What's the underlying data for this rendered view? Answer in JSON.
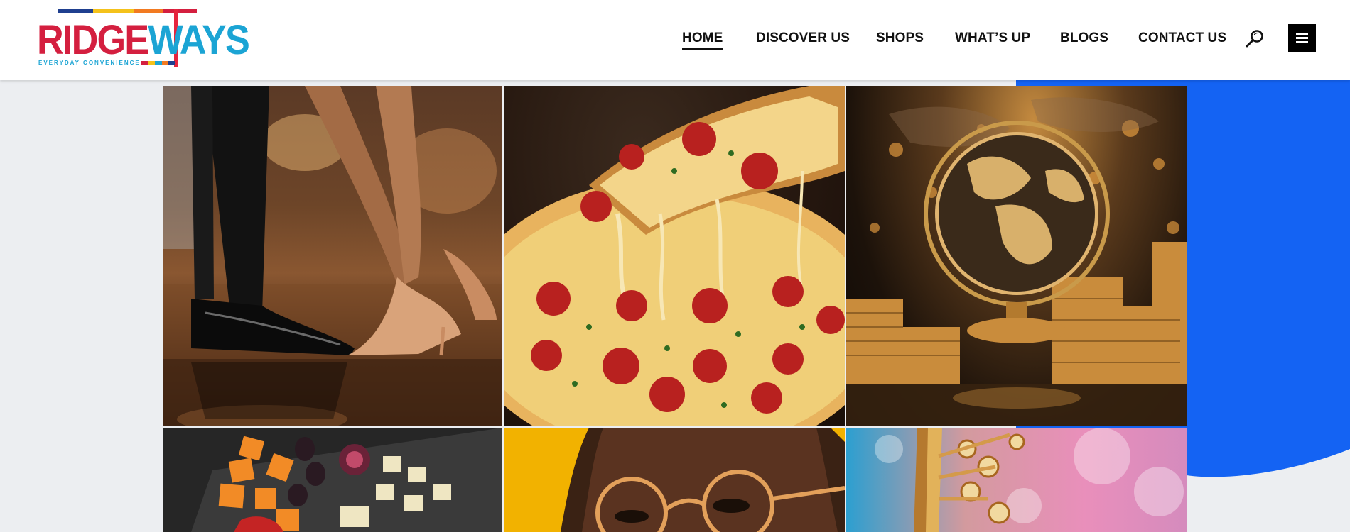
{
  "brand": {
    "name_part1": "RIDGE",
    "name_part2": "WAYS",
    "tagline": "EVERYDAY CONVENIENCE",
    "colors": {
      "red": "#d41f3f",
      "blue": "#1ba4d4",
      "yellow": "#f4c21b",
      "navy": "#1f3f8f",
      "orange": "#f27a21"
    }
  },
  "nav": {
    "items": [
      {
        "label": "HOME",
        "active": true
      },
      {
        "label": "DISCOVER US",
        "active": false
      },
      {
        "label": "SHOPS",
        "active": false
      },
      {
        "label": "WHAT’S UP",
        "active": false
      },
      {
        "label": "BLOGS",
        "active": false
      },
      {
        "label": "CONTACT US",
        "active": false
      }
    ],
    "search_icon": "search-icon",
    "menu_icon": "hamburger-menu-icon"
  },
  "accent_color": "#1463f3",
  "gallery": {
    "tiles": [
      {
        "subject": "dance-shoes-photo"
      },
      {
        "subject": "pepperoni-pizza-photo"
      },
      {
        "subject": "golden-globe-coins-photo"
      },
      {
        "subject": "cheese-platter-photo"
      },
      {
        "subject": "person-glasses-photo"
      },
      {
        "subject": "saxophone-bokeh-photo"
      }
    ]
  }
}
